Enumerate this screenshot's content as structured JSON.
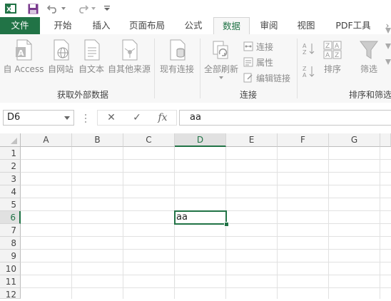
{
  "quick_access": {
    "icons": [
      "excel-logo-icon",
      "save-icon",
      "undo-icon",
      "redo-icon",
      "customize-qat-icon"
    ]
  },
  "tabs": [
    {
      "label": "文件"
    },
    {
      "label": "开始"
    },
    {
      "label": "插入"
    },
    {
      "label": "页面布局"
    },
    {
      "label": "公式"
    },
    {
      "label": "数据"
    },
    {
      "label": "审阅"
    },
    {
      "label": "视图"
    },
    {
      "label": "PDF工具"
    }
  ],
  "active_tab": "数据",
  "ribbon": {
    "get_external": {
      "buttons": [
        "自 Access",
        "自网站",
        "自文本",
        "自其他来源"
      ],
      "group_label": "获取外部数据"
    },
    "existing_connections": "现有连接",
    "connections": {
      "refresh_all": "全部刷新",
      "connections": "连接",
      "properties": "属性",
      "edit_links": "编辑链接",
      "group_label": "连接"
    },
    "sort_filter": {
      "sort": "排序",
      "filter": "筛选",
      "group_label": "排序和筛选"
    }
  },
  "formula_bar": {
    "name_box": "D6",
    "cancel": "✕",
    "enter": "✓",
    "fx": "fx",
    "value": "aa"
  },
  "sheet": {
    "columns": [
      "A",
      "B",
      "C",
      "D",
      "E",
      "F",
      "G"
    ],
    "rows": [
      "1",
      "2",
      "3",
      "4",
      "5",
      "6",
      "7",
      "8",
      "9",
      "10",
      "11",
      "12"
    ],
    "selected_column": "D",
    "selected_row": "6",
    "active_cell_text": "aa"
  },
  "colors": {
    "accent": "#217346",
    "ribbon_bg": "#f7f7f7",
    "header_bg": "#f3f3f3"
  }
}
